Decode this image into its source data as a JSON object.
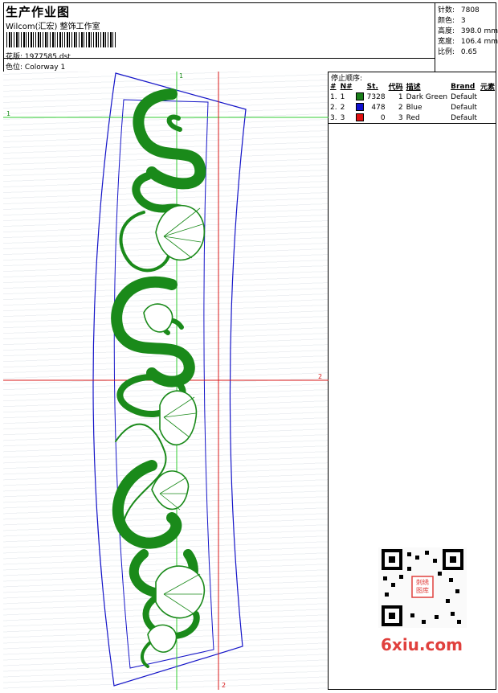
{
  "header": {
    "title": "生产作业图",
    "company": "Wilcom(汇宏) 整饰工作室",
    "design_label": "花版:",
    "design_value": "1977585.dst",
    "colorway_label": "色位:",
    "colorway_value": "Colorway 1"
  },
  "stats": [
    {
      "label": "针数:",
      "value": "7808"
    },
    {
      "label": "颜色:",
      "value": "3"
    },
    {
      "label": "高度:",
      "value": "398.0 mm"
    },
    {
      "label": "宽度:",
      "value": "106.4 mm"
    },
    {
      "label": "比例:",
      "value": "0.65"
    }
  ],
  "stop_sequence": {
    "title": "停止顺序:",
    "columns": [
      "#",
      "N#",
      "St.",
      "代码",
      "描述",
      "Brand",
      "元素"
    ],
    "rows": [
      {
        "idx": "1.",
        "n": "1",
        "color": "#1a7f1a",
        "st": "7328",
        "code": "1",
        "desc": "Dark Green",
        "brand": "Default"
      },
      {
        "idx": "2.",
        "n": "2",
        "color": "#1010d0",
        "st": "478",
        "code": "2",
        "desc": "Blue",
        "brand": "Default"
      },
      {
        "idx": "3.",
        "n": "3",
        "color": "#e01010",
        "st": "0",
        "code": "3",
        "desc": "Red",
        "brand": "Default"
      }
    ]
  },
  "guides": {
    "green_top": "1",
    "green_left": "1",
    "red_right": "2",
    "red_bottom": "2"
  },
  "watermark": {
    "stamp": "刺绣图库",
    "site": "6xiu.com"
  },
  "colors": {
    "green": "#1a8a1a",
    "blue": "#1414c8",
    "red": "#d81818",
    "guide_green": "#33cc33"
  }
}
